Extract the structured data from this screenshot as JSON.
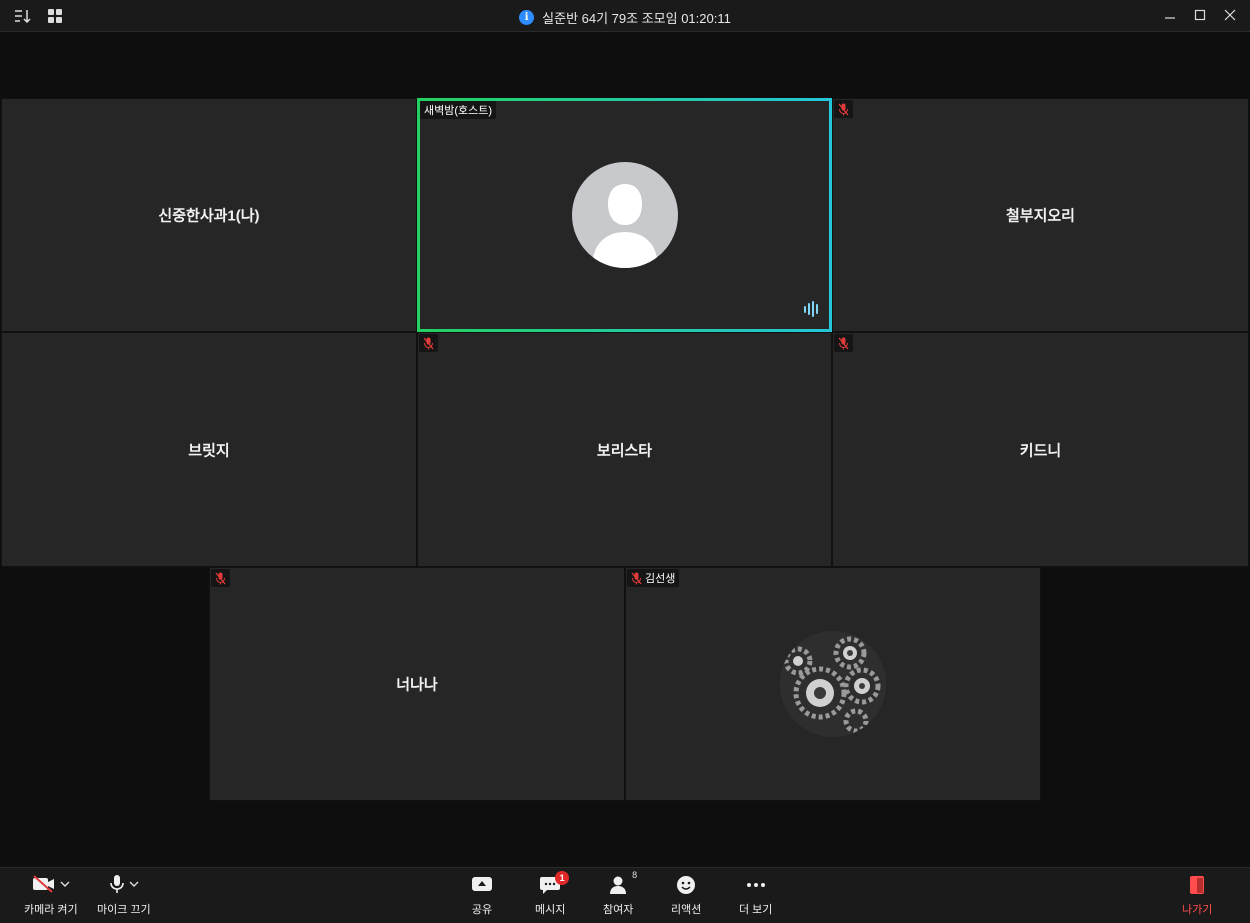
{
  "window": {
    "title": "실준반 64기 79조 조모임 01:20:11"
  },
  "tiles": [
    {
      "name": "신중한사과1(나)"
    },
    {
      "tag": "새벽밤(호스트)"
    },
    {
      "name": "철부지오리"
    },
    {
      "name": "브릿지"
    },
    {
      "name": "보리스타"
    },
    {
      "name": "키드니"
    },
    {
      "name": "너나나"
    },
    {
      "tag": "김선생"
    }
  ],
  "toolbar": {
    "camera_label": "카메라 켜기",
    "mic_label": "마이크 끄기",
    "share_label": "공유",
    "chat_label": "메시지",
    "chat_badge": "1",
    "participants_label": "참여자",
    "participants_count": "8",
    "reactions_label": "리액션",
    "more_label": "더 보기",
    "leave_label": "나가기"
  },
  "colors": {
    "active_border_start": "#23d160",
    "active_border_end": "#23c7d9",
    "leave": "#ff4d4d",
    "badge": "#e02828",
    "info": "#2d8cff"
  }
}
